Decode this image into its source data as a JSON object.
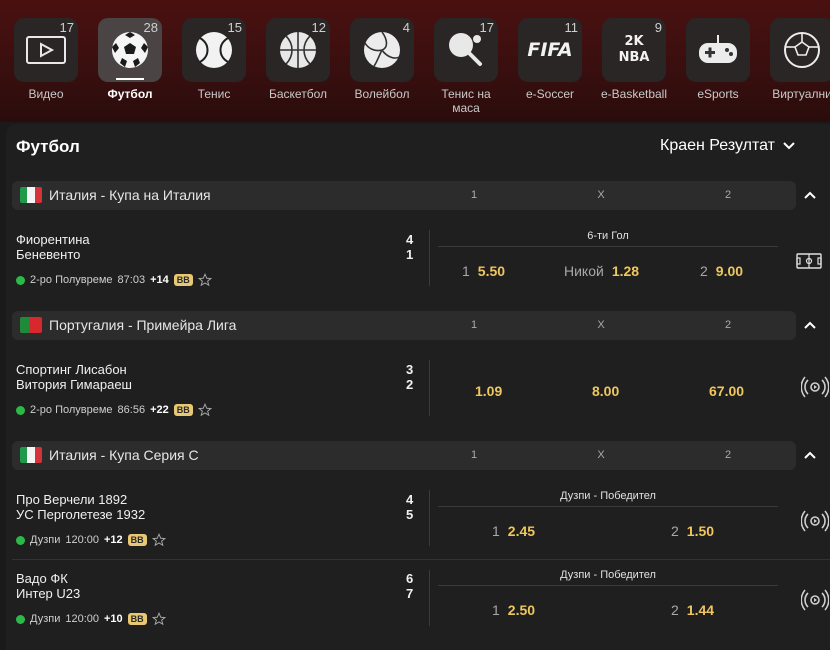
{
  "sports": [
    {
      "label": "Видео",
      "count": "17",
      "icon": "video-icon"
    },
    {
      "label": "Футбол",
      "count": "28",
      "icon": "soccer-ball-icon",
      "active": true
    },
    {
      "label": "Тенис",
      "count": "15",
      "icon": "tennis-ball-icon"
    },
    {
      "label": "Баскетбол",
      "count": "12",
      "icon": "basketball-icon"
    },
    {
      "label": "Волейбол",
      "count": "4",
      "icon": "volleyball-icon"
    },
    {
      "label": "Тенис на маса",
      "count": "17",
      "icon": "table-tennis-icon"
    },
    {
      "label": "e-Soccer",
      "count": "11",
      "icon": "fifa-icon",
      "icon_text": "FIFA"
    },
    {
      "label": "e-Basketball",
      "count": "9",
      "icon": "nba2k-icon",
      "icon_text": "2K NBA"
    },
    {
      "label": "eSports",
      "count": "",
      "icon": "gamepad-icon"
    },
    {
      "label": "Виртуални",
      "count": "",
      "icon": "virtual-ball-icon"
    }
  ],
  "panel": {
    "title": "Футбол",
    "market": "Краен Резултат"
  },
  "columns": {
    "c1": "1",
    "cx": "X",
    "c2": "2"
  },
  "leagues": [
    {
      "name": "Италия - Купа на Италия",
      "flag": "italy",
      "events": [
        {
          "home": "Фиорентина",
          "away": "Беневенто",
          "home_score": "4",
          "away_score": "1",
          "status": "2-ро Полувреме",
          "time": "87:03",
          "more": "+14",
          "badge": "BB",
          "submarket": "6-ти Гол",
          "odds": [
            {
              "label": "1",
              "value": "5.50"
            },
            {
              "label": "Никой",
              "value": "1.28"
            },
            {
              "label": "2",
              "value": "9.00"
            }
          ],
          "side_icon": "pitch-icon"
        }
      ]
    },
    {
      "name": "Португалия - Примейра Лига",
      "flag": "portugal",
      "events": [
        {
          "home": "Спортинг Лисабон",
          "away": "Витория Гимараеш",
          "home_score": "3",
          "away_score": "2",
          "status": "2-ро Полувреме",
          "time": "86:56",
          "more": "+22",
          "badge": "BB",
          "submarket": "",
          "odds": [
            {
              "label": "",
              "value": "1.09"
            },
            {
              "label": "",
              "value": "8.00"
            },
            {
              "label": "",
              "value": "67.00"
            }
          ],
          "side_icon": "live-stream-icon"
        }
      ]
    },
    {
      "name": "Италия - Купа Серия С",
      "flag": "italy",
      "events": [
        {
          "home": "Про Верчели 1892",
          "away": "УС Перголетезе 1932",
          "home_score": "4",
          "away_score": "5",
          "status": "Дузпи",
          "time": "120:00",
          "more": "+12",
          "badge": "BB",
          "submarket": "Дузпи - Победител",
          "odds": [
            {
              "label": "1",
              "value": "2.45"
            },
            {
              "label": "2",
              "value": "1.50"
            }
          ],
          "side_icon": "live-stream-icon"
        },
        {
          "home": "Вадо ФК",
          "away": "Интер U23",
          "home_score": "6",
          "away_score": "7",
          "status": "Дузпи",
          "time": "120:00",
          "more": "+10",
          "badge": "BB",
          "submarket": "Дузпи - Победител",
          "odds": [
            {
              "label": "1",
              "value": "2.50"
            },
            {
              "label": "2",
              "value": "1.44"
            }
          ],
          "side_icon": "live-stream-icon"
        }
      ]
    }
  ],
  "colors": {
    "accent_odd": "#f0c75e",
    "live_dot": "#2db84a",
    "badge": "#e8c872"
  }
}
